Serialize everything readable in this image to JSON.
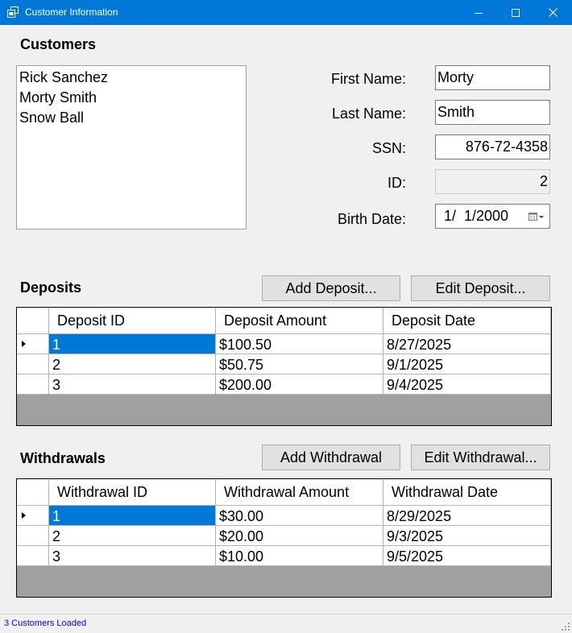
{
  "window": {
    "title": "Customer Information"
  },
  "customers": {
    "title": "Customers",
    "items": [
      "Rick Sanchez",
      "Morty Smith",
      "Snow Ball"
    ]
  },
  "details": {
    "first_name_label": "First Name:",
    "first_name_value": "Morty",
    "last_name_label": "Last Name:",
    "last_name_value": "Smith",
    "ssn_label": "SSN:",
    "ssn_value": "876-72-4358",
    "id_label": "ID:",
    "id_value": "2",
    "birth_date_label": "Birth Date:",
    "birth_date_value": "1/  1/2000"
  },
  "deposits": {
    "title": "Deposits",
    "add_button": "Add Deposit...",
    "edit_button": "Edit Deposit...",
    "columns": [
      "Deposit ID",
      "Deposit Amount",
      "Deposit Date"
    ],
    "rows": [
      [
        "1",
        "$100.50",
        "8/27/2025"
      ],
      [
        "2",
        "$50.75",
        "9/1/2025"
      ],
      [
        "3",
        "$200.00",
        "9/4/2025"
      ]
    ]
  },
  "withdrawals": {
    "title": "Withdrawals",
    "add_button": "Add Withdrawal",
    "edit_button": "Edit Withdrawal...",
    "columns": [
      "Withdrawal ID",
      "Withdrawal Amount",
      "Withdrawal Date"
    ],
    "rows": [
      [
        "1",
        "$30.00",
        "8/29/2025"
      ],
      [
        "2",
        "$20.00",
        "9/3/2025"
      ],
      [
        "3",
        "$10.00",
        "9/5/2025"
      ]
    ]
  },
  "status": {
    "text": "3 Customers Loaded"
  },
  "colors": {
    "titlebar": "#0078d7",
    "selection": "#0078d7",
    "status_text": "#0000ff",
    "grid_background": "#a0a0a0"
  }
}
